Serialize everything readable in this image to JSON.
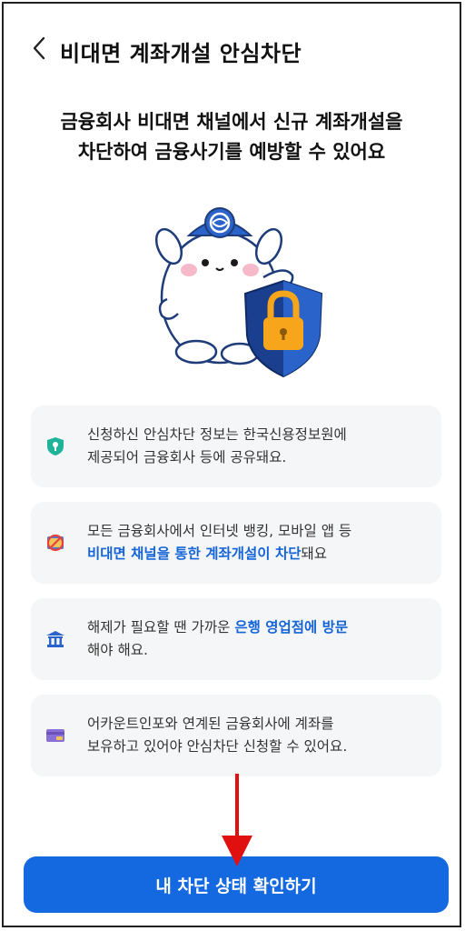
{
  "header": {
    "title": "비대면 계좌개설 안심차단",
    "back_icon": "chevron-left-icon"
  },
  "headline": {
    "line1": "금융회사 비대면 채널에서 신규 계좌개설을",
    "line2": "차단하여 금융사기를 예방할 수 있어요"
  },
  "illustration": {
    "description_icons": [
      "mascot-icon",
      "shield-lock-icon"
    ]
  },
  "info_cards": [
    {
      "icon": "shield-key-icon",
      "line1": "신청하신 안심차단 정보는 한국신용정보원에",
      "line2": "제공되어 금융회사 등에 공유돼요."
    },
    {
      "icon": "no-mobile-icon",
      "line1": "모든 금융회사에서 인터넷 뱅킹, 모바일 앱 등",
      "line2_highlight": "비대면 채널을 통한 계좌개설이 차단",
      "line2_rest": "돼요"
    },
    {
      "icon": "bank-icon",
      "line1_plain": "해제가 필요할 땐 가까운 ",
      "line1_highlight": "은행 영업점에 방문",
      "line2": "해야 해요."
    },
    {
      "icon": "card-icon",
      "line1": "어카운트인포와 연계된 금융회사에 계좌를",
      "line2": "보유하고 있어야 안심차단 신청할 수 있어요."
    }
  ],
  "cta": {
    "label": "내 차단 상태 확인하기"
  },
  "colors": {
    "accent": "#1468e0",
    "highlight_text": "#1565d8",
    "card_bg": "#f5f6f8",
    "annotation_arrow": "#e01010"
  }
}
